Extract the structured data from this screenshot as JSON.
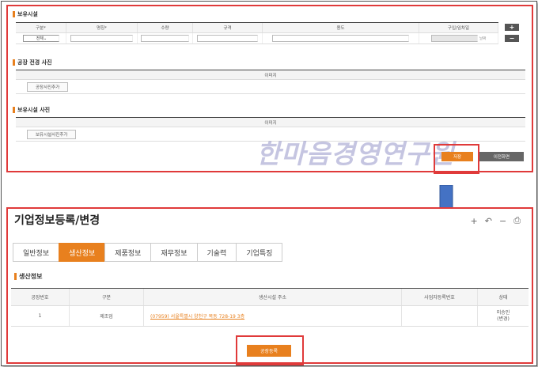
{
  "top": {
    "facilities_title": "보유시설",
    "facility_headers": [
      "구분*",
      "명칭*",
      "수량",
      "규격",
      "용도",
      "구입/임차일"
    ],
    "facility_row": {
      "type_value": "전체",
      "date_placeholder": "날짜"
    },
    "add_row": "+",
    "remove_row": "−",
    "factory_photo_title": "공장 전경 사진",
    "factory_photo_header": "이미지",
    "factory_photo_add": "공장사진추가",
    "facility_photo_title": "보유시설 사진",
    "facility_photo_header": "이미지",
    "facility_photo_add": "보유시설사진추가",
    "save_label": "저장",
    "list_label": "이전화면"
  },
  "watermark": "한마음경영연구원",
  "bottom": {
    "page_title": "기업정보등록/변경",
    "tools": [
      "+",
      "↶",
      "−",
      "⎙"
    ],
    "tabs": [
      {
        "label": "일반정보",
        "active": false
      },
      {
        "label": "생산정보",
        "active": true
      },
      {
        "label": "제품정보",
        "active": false
      },
      {
        "label": "재무정보",
        "active": false
      },
      {
        "label": "기술력",
        "active": false
      },
      {
        "label": "기업특징",
        "active": false
      }
    ],
    "section_title": "생산정보",
    "table": {
      "headers": [
        "공장번호",
        "구분",
        "생산시설 주소",
        "사업자등록번호",
        "상태"
      ],
      "rows": [
        {
          "no": "1",
          "type": "제조업",
          "address": "(07959) 서울특별시 양천구 목동 728-19 3층",
          "biz_no": "",
          "status_line1": "미승인",
          "status_line2": "(변경)"
        }
      ]
    },
    "register_label": "공장등록"
  },
  "colors": {
    "accent": "#e8801e",
    "highlight": "#e03a3a",
    "arrow": "#4472c4"
  }
}
